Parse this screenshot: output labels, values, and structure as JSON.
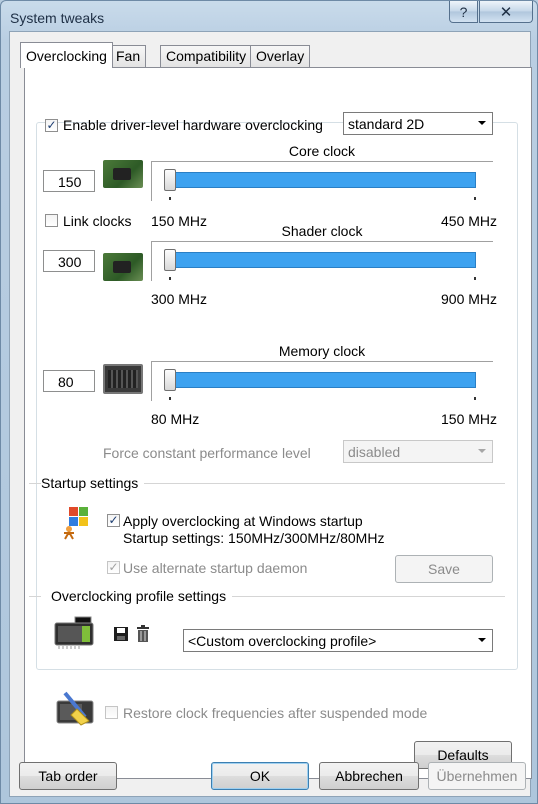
{
  "window": {
    "title": "System tweaks",
    "help_glyph": "?",
    "close_glyph": "✕"
  },
  "tabs": [
    {
      "label": "Overclocking",
      "active": true
    },
    {
      "label": "Fan"
    },
    {
      "label": "Compatibility"
    },
    {
      "label": "Overlay"
    }
  ],
  "overclocking": {
    "enable_label": "Enable driver-level hardware overclocking",
    "enable_checked": true,
    "mode_value": "standard 2D",
    "link_clocks_label": "Link clocks",
    "link_clocks_checked": false,
    "sliders": {
      "core": {
        "title": "Core clock",
        "value": "150",
        "min_label": "150 MHz",
        "max_label": "450 MHz"
      },
      "shader": {
        "title": "Shader clock",
        "value": "300",
        "min_label": "300 MHz",
        "max_label": "900 MHz"
      },
      "memory": {
        "title": "Memory clock",
        "value": "80",
        "min_label": "80 MHz",
        "max_label": "150 MHz"
      }
    },
    "force_perf_label": "Force constant performance level",
    "force_perf_value": "disabled"
  },
  "startup": {
    "section_title": "Startup settings",
    "apply_label": "Apply overclocking at Windows startup",
    "apply_checked": true,
    "settings_text": "Startup settings: 150MHz/300MHz/80MHz",
    "daemon_label": "Use alternate startup daemon",
    "daemon_checked": true,
    "save_label": "Save"
  },
  "profiles": {
    "section_title": "Overclocking profile settings",
    "profile_value": "<Custom overclocking profile>"
  },
  "restore_label": "Restore clock frequencies after suspended mode",
  "defaults_label": "Defaults",
  "footer": {
    "tab_order_label": "Tab order",
    "ok_label": "OK",
    "cancel_label": "Abbrechen",
    "apply_label": "Übernehmen"
  },
  "check_glyph": "✓",
  "icons": [
    "help-icon",
    "close-icon",
    "gpu-chip-icon",
    "memory-chip-icon",
    "windows-startup-icon",
    "save-disk-icon",
    "trash-icon",
    "video-card-icon",
    "restore-cleaning-icon",
    "dropdown-arrow-icon"
  ]
}
